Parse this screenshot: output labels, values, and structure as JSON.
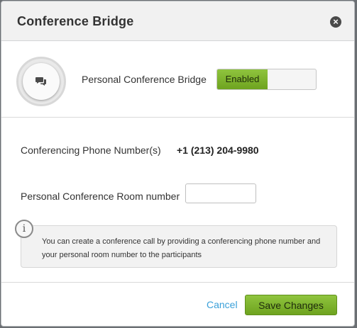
{
  "dialog": {
    "title": "Conference Bridge",
    "close_icon": "close-icon"
  },
  "bridge": {
    "label": "Personal Conference Bridge",
    "toggle_label": "Enabled",
    "toggle_state": "on",
    "avatar_icon": "chat-bubbles-icon"
  },
  "phone": {
    "label": "Conferencing Phone Number(s)",
    "value": "+1 (213) 204-9980"
  },
  "room": {
    "label": "Personal Conference Room number",
    "value": "",
    "placeholder": ""
  },
  "info": {
    "icon": "info-icon",
    "icon_glyph": "i",
    "text": "You can create a conference call by providing a conferencing phone number and your personal room number to the participants"
  },
  "footer": {
    "cancel_label": "Cancel",
    "save_label": "Save Changes"
  },
  "colors": {
    "accent_green": "#7cb32a",
    "link_blue": "#3aa0d9"
  }
}
